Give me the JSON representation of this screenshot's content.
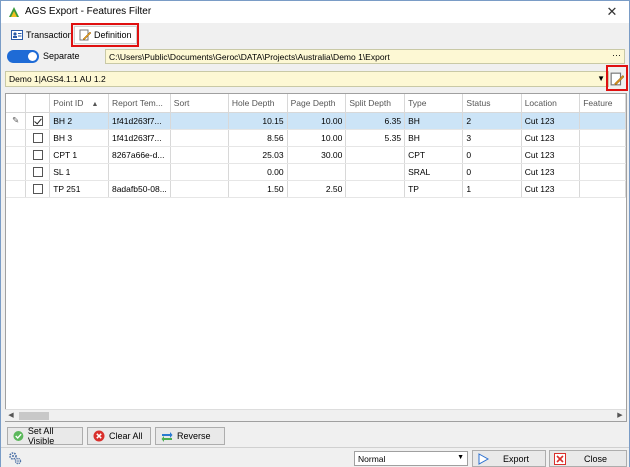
{
  "window": {
    "title": "AGS Export - Features Filter",
    "close_glyph": "✕"
  },
  "tabs": [
    {
      "label": "Transaction",
      "icon": "id-card-icon"
    },
    {
      "label": "Definition",
      "icon": "edit-document-icon",
      "active": true
    }
  ],
  "separate": {
    "label": "Separate",
    "toggled": true,
    "path": "C:\\Users\\Public\\Documents\\Geroc\\DATA\\Projects\\Australia\\Demo 1\\Export",
    "browse_glyph": "···"
  },
  "definition": {
    "selected": "Demo 1|AGS4.1.1 AU 1.2"
  },
  "grid": {
    "columns": [
      "Point ID",
      "Report Tem...",
      "Sort",
      "Hole Depth",
      "Page Depth",
      "Split Depth",
      "Type",
      "Status",
      "Location",
      "Feature"
    ],
    "sort_glyph": "▲",
    "edit_glyph": "✎",
    "rows": [
      {
        "checked": true,
        "selected": true,
        "point_id": "BH 2",
        "report_tem": "1f41d263f7...",
        "sort": "",
        "hole_depth": "10.15",
        "page_depth": "10.00",
        "split_depth": "6.35",
        "type": "BH",
        "status": "2",
        "location": "Cut 123",
        "feature": ""
      },
      {
        "checked": false,
        "selected": false,
        "point_id": "BH 3",
        "report_tem": "1f41d263f7...",
        "sort": "",
        "hole_depth": "8.56",
        "page_depth": "10.00",
        "split_depth": "5.35",
        "type": "BH",
        "status": "3",
        "location": "Cut 123",
        "feature": ""
      },
      {
        "checked": false,
        "selected": false,
        "point_id": "CPT 1",
        "report_tem": "8267a66e-d...",
        "sort": "",
        "hole_depth": "25.03",
        "page_depth": "30.00",
        "split_depth": "",
        "type": "CPT",
        "status": "0",
        "location": "Cut 123",
        "feature": ""
      },
      {
        "checked": false,
        "selected": false,
        "point_id": "SL 1",
        "report_tem": "",
        "sort": "",
        "hole_depth": "0.00",
        "page_depth": "",
        "split_depth": "",
        "type": "SRAL",
        "status": "0",
        "location": "Cut 123",
        "feature": ""
      },
      {
        "checked": false,
        "selected": false,
        "point_id": "TP 251",
        "report_tem": "8adafb50-08...",
        "sort": "",
        "hole_depth": "1.50",
        "page_depth": "2.50",
        "split_depth": "",
        "type": "TP",
        "status": "1",
        "location": "Cut 123",
        "feature": ""
      }
    ]
  },
  "scroll": {
    "left_glyph": "◀",
    "right_glyph": "▶"
  },
  "buttons": {
    "set_all_visible": "Set All Visible",
    "clear_all": "Clear All",
    "reverse": "Reverse"
  },
  "status": {
    "mode": "Normal",
    "export": "Export",
    "close": "Close"
  },
  "colors": {
    "accent": "#1e6bd6",
    "highlight": "#e01010",
    "selected_row": "#cce4f7",
    "input_bg": "#fdf8d4"
  }
}
